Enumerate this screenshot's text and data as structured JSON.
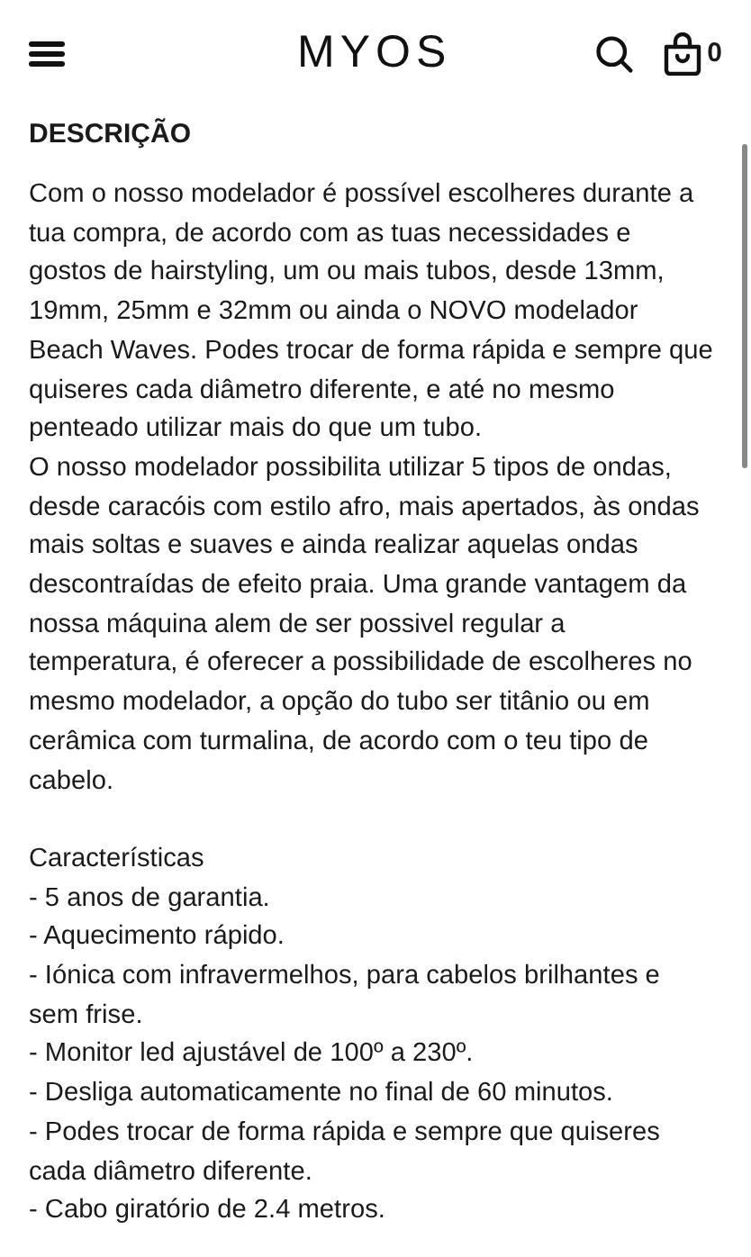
{
  "header": {
    "logo": "MYOS",
    "cart_count": "0"
  },
  "section": {
    "title": "DESCRIÇÃO",
    "paragraphs": [
      "Com o nosso modelador é possível escolheres durante a tua compra, de acordo com as tuas necessidades e gostos de hairstyling, um ou mais tubos, desde 13mm, 19mm, 25mm e 32mm ou ainda o NOVO modelador Beach Waves. Podes trocar de forma rápida e sempre que quiseres cada diâmetro diferente, e até no mesmo penteado utilizar mais do que um tubo.",
      "O nosso modelador possibilita utilizar 5 tipos de ondas, desde caracóis com estilo afro, mais apertados, às ondas mais soltas e suaves e ainda realizar aquelas ondas descontraídas de efeito praia. Uma grande vantagem da nossa máquina alem de ser possivel regular a temperatura, é oferecer a possibilidade de escolheres no mesmo modelador, a opção do tubo ser titânio ou em cerâmica com turmalina, de acordo com o teu tipo de cabelo."
    ],
    "features_title": "Características",
    "features": [
      "- 5 anos de garantia.",
      "- Aquecimento rápido.",
      "- Iónica com infravermelhos, para cabelos brilhantes e sem frise.",
      "- Monitor led ajustável de 100º a 230º.",
      "- Desliga automaticamente no final de 60 minutos.",
      "- Podes trocar de forma rápida e sempre que quiseres cada diâmetro diferente.",
      "- Cabo giratório de 2.4 metros."
    ]
  }
}
